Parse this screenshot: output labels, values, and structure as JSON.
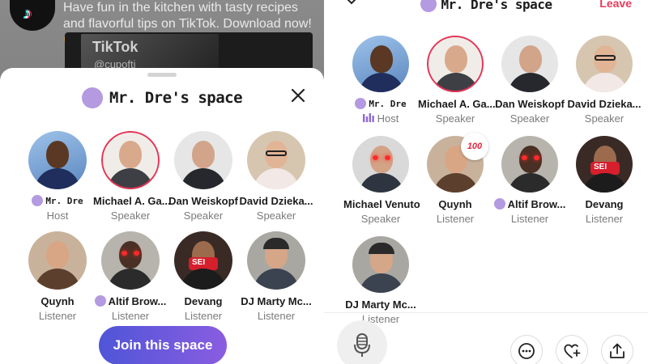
{
  "feed": {
    "caption": "Have fun in the kitchen with tasty recipes and flavorful tips on TikTok. Download now! 😋",
    "video_brand": "TikTok",
    "video_handle": "@cupofti"
  },
  "left_sheet": {
    "space_title": "Mr. Dre's space",
    "close_icon": "close-icon",
    "join_button": "Join this space",
    "participants": [
      {
        "name": "Mr. Dre",
        "role": "Host",
        "dot": true,
        "mono": true
      },
      {
        "name": "Michael A. Ga...",
        "role": "Speaker",
        "dot": false
      },
      {
        "name": "Dan Weiskopf",
        "role": "Speaker",
        "dot": false
      },
      {
        "name": "David Dzieka...",
        "role": "Speaker",
        "dot": false
      },
      {
        "name": "Quynh",
        "role": "Listener",
        "dot": false
      },
      {
        "name": "Altif Brow...",
        "role": "Listener",
        "dot": true
      },
      {
        "name": "Devang",
        "role": "Listener",
        "dot": false
      },
      {
        "name": "DJ Marty Mc...",
        "role": "Listener",
        "dot": false
      }
    ]
  },
  "right_panel": {
    "space_title": "Mr. Dre's space",
    "leave_label": "Leave",
    "badge_100": "100",
    "participants": [
      {
        "name": "Mr. Dre",
        "role": "Host",
        "dot": true,
        "mono": true
      },
      {
        "name": "Michael A. Ga...",
        "role": "Speaker",
        "dot": false
      },
      {
        "name": "Dan Weiskopf",
        "role": "Speaker",
        "dot": false
      },
      {
        "name": "David Dzieka...",
        "role": "Speaker",
        "dot": false
      },
      {
        "name": "Michael Venuto",
        "role": "Speaker",
        "dot": false
      },
      {
        "name": "Quynh",
        "role": "Listener",
        "dot": false
      },
      {
        "name": "Altif Brow...",
        "role": "Listener",
        "dot": true
      },
      {
        "name": "Devang",
        "role": "Listener",
        "dot": false
      },
      {
        "name": "DJ Marty Mc...",
        "role": "Listener",
        "dot": false
      }
    ],
    "icons": [
      "chevron-down-icon",
      "microphone-icon",
      "more-options-icon",
      "heart-plus-icon",
      "share-icon"
    ]
  },
  "colors": {
    "accent_purple": "#b49ae0",
    "leave_red": "#e63b5c",
    "join_gradient_start": "#4f55d8",
    "join_gradient_end": "#8a5de0"
  }
}
